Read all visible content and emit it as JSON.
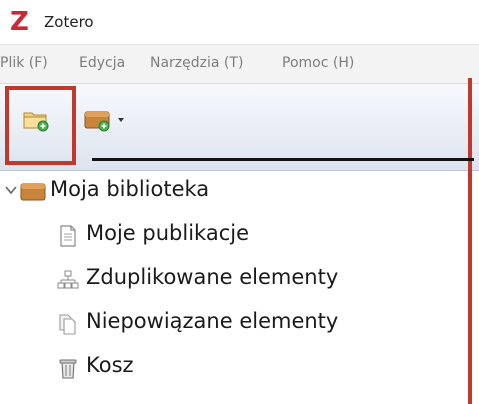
{
  "window": {
    "logo_letter": "Z",
    "title": "Zotero"
  },
  "menubar": {
    "items": [
      {
        "label": "Plik (F)"
      },
      {
        "label": "Edycja"
      },
      {
        "label": "Narzędzia (T)"
      },
      {
        "label": "Pomoc (H)"
      }
    ]
  },
  "toolbar": {
    "new_collection_icon": "new-folder-icon",
    "new_library_icon": "new-library-icon",
    "dropdown_icon": "dropdown-arrow-icon"
  },
  "tree": {
    "root": {
      "label": "Moja biblioteka",
      "icon": "library-icon",
      "expanded": true
    },
    "items": [
      {
        "label": "Moje publikacje",
        "icon": "document-icon"
      },
      {
        "label": "Zduplikowane elementy",
        "icon": "duplicate-icon"
      },
      {
        "label": "Niepowiązane elementy",
        "icon": "unfiled-icon"
      },
      {
        "label": "Kosz",
        "icon": "trash-icon"
      }
    ]
  },
  "colors": {
    "logo_red": "#cc2936",
    "annotation_red": "#c0392b",
    "arrow": "#111111"
  }
}
